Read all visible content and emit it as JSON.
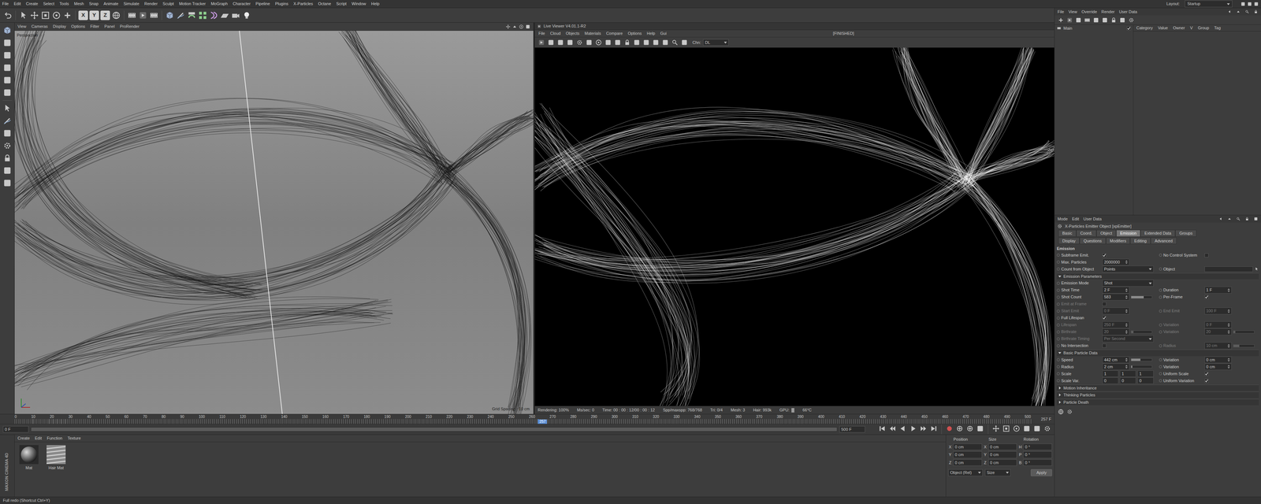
{
  "menu_bar": {
    "items": [
      "File",
      "Edit",
      "Create",
      "Select",
      "Tools",
      "Mesh",
      "Snap",
      "Animate",
      "Simulate",
      "Render",
      "Sculpt",
      "Motion Tracker",
      "MoGraph",
      "Character",
      "Pipeline",
      "Plugins",
      "X-Particles",
      "Octane",
      "Script",
      "Window",
      "Help"
    ],
    "layout_label": "Layout:",
    "layout_value": "Startup"
  },
  "toolbar": {
    "axis_buttons": [
      "X",
      "Y",
      "Z"
    ]
  },
  "viewport": {
    "menu": [
      "View",
      "Cameras",
      "Display",
      "Options",
      "Filter",
      "Panel",
      "ProRender"
    ],
    "camera": "Perspective",
    "grid_spacing": "Grid Spacing : 10 cm"
  },
  "live_viewer": {
    "title": "Live Viewer V4.01.1-R2",
    "menu": [
      "File",
      "Cloud",
      "Objects",
      "Materials",
      "Compare",
      "Options",
      "Help",
      "Gui"
    ],
    "state": "[FINISHED]",
    "channel_label": "Chn:",
    "channel_value": "DL",
    "status": [
      "Rendering: 100%",
      "Ms/sec: 0",
      "Time: 00 : 00 : 12/00 : 00 : 12",
      "Spp/maxspp: 768/768",
      "Tri: 0/4",
      "Mesh: 3",
      "Hair: 993k",
      "GPU:",
      "66°C"
    ]
  },
  "take_manager": {
    "menu": [
      "File",
      "View",
      "Override",
      "Render",
      "User Data"
    ],
    "takes": [
      {
        "label": "Main",
        "checked": true
      }
    ],
    "columns": [
      "Category",
      "Value",
      "Owner",
      "V",
      "Group",
      "Tag"
    ]
  },
  "attributes": {
    "menu": [
      "Mode",
      "Edit",
      "User Data"
    ],
    "object_title": "X-Particles Emitter Object [xpEmitter]",
    "tab_rows": [
      [
        {
          "label": "Basic",
          "selected": false
        },
        {
          "label": "Coord.",
          "selected": false
        },
        {
          "label": "Object",
          "selected": false
        },
        {
          "label": "Emission",
          "selected": true
        },
        {
          "label": "Extended Data",
          "selected": false
        },
        {
          "label": "Groups",
          "selected": false
        }
      ],
      [
        {
          "label": "Display",
          "selected": false
        },
        {
          "label": "Questions",
          "selected": false
        },
        {
          "label": "Modifiers",
          "selected": false
        },
        {
          "label": "Editing",
          "selected": false
        },
        {
          "label": "Advanced",
          "selected": false
        }
      ]
    ],
    "section": "Emission",
    "rows": [
      {
        "kind": "fields",
        "cells": [
          {
            "kind": "check",
            "label": "Subframe Emit.",
            "checked": true,
            "disabled": false
          },
          {
            "kind": "check",
            "label": "No Control System",
            "checked": false,
            "disabled": false
          }
        ]
      },
      {
        "kind": "fields",
        "cells": [
          {
            "kind": "number",
            "label": "Max. Particles",
            "value": "2000000",
            "disabled": false
          }
        ]
      },
      {
        "kind": "fields",
        "cells": [
          {
            "kind": "dropdown",
            "label": "Count from Object",
            "value": "Points",
            "disabled": false
          },
          {
            "kind": "link",
            "label": "Object",
            "disabled": false
          }
        ]
      },
      {
        "kind": "group",
        "title": "Emission Parameters",
        "expanded": true
      },
      {
        "kind": "fields",
        "cells": [
          {
            "kind": "dropdown",
            "label": "Emission Mode",
            "value": "Shot",
            "disabled": false
          }
        ]
      },
      {
        "kind": "fields",
        "cells": [
          {
            "kind": "number",
            "label": "Shot Time",
            "value": "2 F",
            "disabled": false
          },
          {
            "kind": "number",
            "label": "Duration",
            "value": "1 F",
            "disabled": false
          }
        ]
      },
      {
        "kind": "fields",
        "cells": [
          {
            "kind": "slider",
            "label": "Shot Count",
            "value": "583",
            "level": 0.6,
            "disabled": false
          },
          {
            "kind": "check",
            "label": "Per-Frame",
            "checked": true,
            "disabled": false
          }
        ]
      },
      {
        "kind": "fields",
        "cells": [
          {
            "kind": "check",
            "label": "Emit at Frame",
            "checked": false,
            "disabled": true
          }
        ]
      },
      {
        "kind": "fields",
        "cells": [
          {
            "kind": "number",
            "label": "Start Emit",
            "value": "0 F",
            "disabled": true
          },
          {
            "kind": "number",
            "label": "End Emit",
            "value": "100 F",
            "disabled": true
          }
        ]
      },
      {
        "kind": "fields",
        "cells": [
          {
            "kind": "check",
            "label": "Full Lifespan",
            "checked": true,
            "disabled": false
          }
        ]
      },
      {
        "kind": "fields",
        "cells": [
          {
            "kind": "number",
            "label": "Lifespan",
            "value": "250 F",
            "disabled": true
          },
          {
            "kind": "number",
            "label": "Variation",
            "value": "0 F",
            "disabled": true
          }
        ]
      },
      {
        "kind": "fields",
        "cells": [
          {
            "kind": "slider",
            "label": "Birthrate",
            "value": "20",
            "level": 0.1,
            "disabled": true
          },
          {
            "kind": "slider",
            "label": "Variation",
            "value": "20",
            "level": 0.1,
            "disabled": true
          }
        ]
      },
      {
        "kind": "fields",
        "cells": [
          {
            "kind": "dropdown",
            "label": "Birthrate Timing",
            "value": "Per Second",
            "disabled": true
          }
        ]
      },
      {
        "kind": "fields",
        "cells": [
          {
            "kind": "check",
            "label": "No Intersection",
            "checked": false,
            "disabled": false
          },
          {
            "kind": "slider",
            "label": "Radius",
            "value": "10 cm",
            "level": 0.3,
            "disabled": true
          }
        ]
      },
      {
        "kind": "group",
        "title": "Basic Particle Data",
        "expanded": true
      },
      {
        "kind": "fields",
        "cells": [
          {
            "kind": "slider",
            "label": "Speed",
            "value": "442 cm",
            "level": 0.45,
            "disabled": false
          },
          {
            "kind": "number",
            "label": "Variation",
            "value": "0 cm",
            "disabled": false
          }
        ]
      },
      {
        "kind": "fields",
        "cells": [
          {
            "kind": "slider",
            "label": "Radius",
            "value": "2 cm",
            "level": 0.05,
            "disabled": false
          },
          {
            "kind": "number",
            "label": "Variation",
            "value": "0 cm",
            "disabled": false
          }
        ]
      },
      {
        "kind": "fields",
        "cells": [
          {
            "kind": "vector",
            "label": "Scale",
            "values": [
              "1",
              "1",
              "1"
            ],
            "disabled": false
          },
          {
            "kind": "check",
            "label": "Uniform Scale",
            "checked": true,
            "disabled": false
          }
        ]
      },
      {
        "kind": "fields",
        "cells": [
          {
            "kind": "vector",
            "label": "Scale Var.",
            "values": [
              "0",
              "0",
              "0"
            ],
            "disabled": false
          },
          {
            "kind": "check",
            "label": "Uniform Variation",
            "checked": true,
            "disabled": false
          }
        ]
      },
      {
        "kind": "group",
        "title": "Motion Inheritance",
        "expanded": false
      },
      {
        "kind": "group",
        "title": "Thinking Particles",
        "expanded": false
      },
      {
        "kind": "group",
        "title": "Particle Death",
        "expanded": false
      }
    ]
  },
  "timeline": {
    "ticks": [
      "0",
      "10",
      "20",
      "30",
      "40",
      "50",
      "60",
      "70",
      "80",
      "90",
      "100",
      "110",
      "120",
      "130",
      "140",
      "150",
      "160",
      "170",
      "180",
      "190",
      "200",
      "210",
      "220",
      "230",
      "240",
      "250",
      "260",
      "270",
      "280",
      "290",
      "300",
      "310",
      "320",
      "330",
      "340",
      "350",
      "360",
      "370",
      "380",
      "390",
      "400",
      "410",
      "420",
      "430",
      "440",
      "450",
      "460",
      "470",
      "480",
      "490",
      "500"
    ],
    "current": {
      "label": "257",
      "level": 0.514
    },
    "current_field": "257 F",
    "start": "0 F",
    "end": "500 F"
  },
  "materials": {
    "menu": [
      "Create",
      "Edit",
      "Function",
      "Texture"
    ],
    "items": [
      {
        "name": "Mat",
        "kind": "sphere"
      },
      {
        "name": "Hair Mat",
        "kind": "hair"
      }
    ]
  },
  "coordinates": {
    "headers": [
      "Position",
      "Size",
      "Rotation"
    ],
    "rows": [
      [
        {
          "axis": "X",
          "value": "0 cm"
        },
        {
          "axis": "X",
          "value": "0 cm"
        },
        {
          "axis": "H",
          "value": "0 °"
        }
      ],
      [
        {
          "axis": "Y",
          "value": "0 cm"
        },
        {
          "axis": "Y",
          "value": "0 cm"
        },
        {
          "axis": "P",
          "value": "0 °"
        }
      ],
      [
        {
          "axis": "Z",
          "value": "0 cm"
        },
        {
          "axis": "Z",
          "value": "0 cm"
        },
        {
          "axis": "B",
          "value": "0 °"
        }
      ]
    ],
    "mode": "Object (Rel)",
    "size_mode": "Size",
    "apply": "Apply"
  },
  "logo": "MAXON CINEMA 4D",
  "status_bar": "Full redo (Shortcut Ctrl+Y)"
}
